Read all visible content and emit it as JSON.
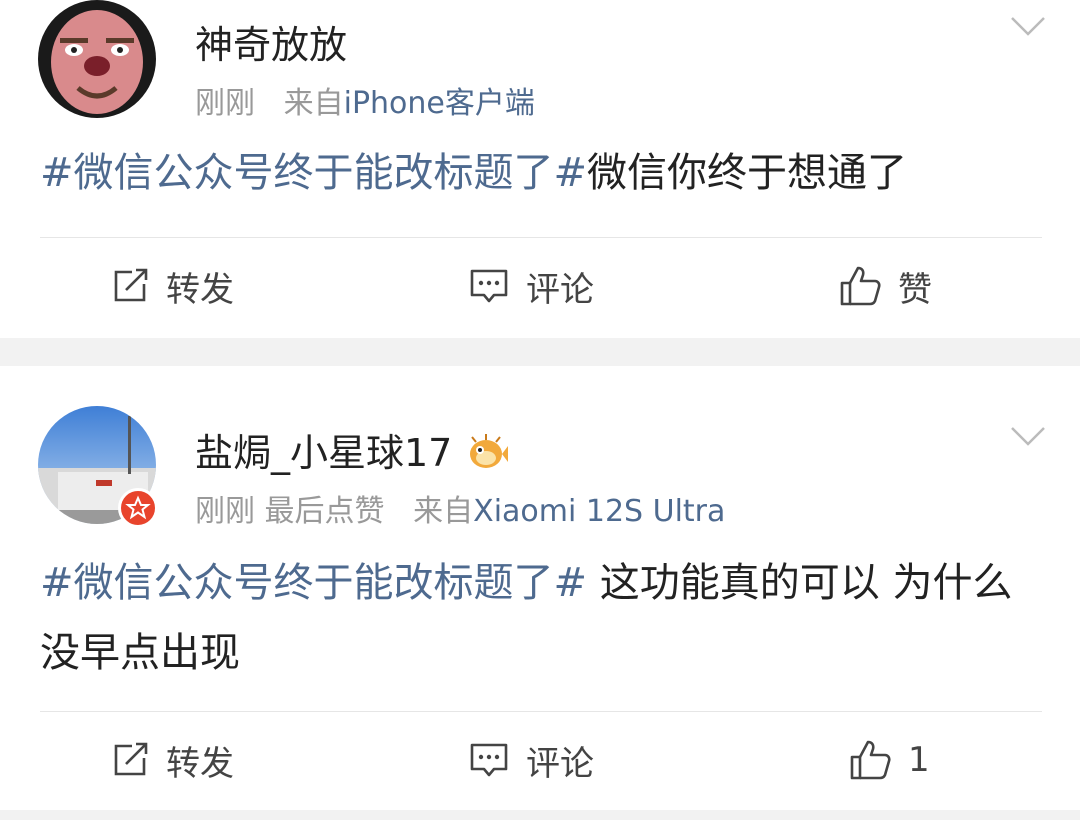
{
  "posts": [
    {
      "username": "神奇放放",
      "time": "刚刚",
      "extra": "",
      "source_prefix": "来自",
      "source": "iPhone客户端",
      "topic": "#微信公众号终于能改标题了#",
      "text": "微信你终于想通了",
      "actions": {
        "repost": "转发",
        "comment": "评论",
        "like": "赞"
      }
    },
    {
      "username": "盐焗_小星球17",
      "time": "刚刚",
      "extra": "最后点赞",
      "source_prefix": "来自",
      "source": "Xiaomi 12S Ultra",
      "topic": "#微信公众号终于能改标题了#",
      "text": " 这功能真的可以 为什么没早点出现",
      "actions": {
        "repost": "转发",
        "comment": "评论",
        "like": "1"
      }
    }
  ],
  "colors": {
    "link": "#4e6a8f",
    "text": "#222222",
    "meta": "#999999",
    "background": "#f2f2f2",
    "badge": "#e8442c"
  },
  "icons": [
    "repost-icon",
    "comment-icon",
    "like-icon",
    "chevron-down-icon",
    "verified-badge-icon",
    "pufferfish-emoji-icon"
  ]
}
